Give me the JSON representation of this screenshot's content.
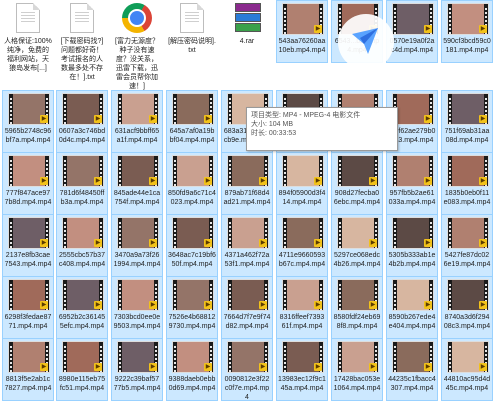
{
  "window": {
    "title": ""
  },
  "colors": {
    "selection": "#cce8ff",
    "selection_border": "#99d1ff",
    "badge": "#f2c21a"
  },
  "files": [
    [
      "人格保证:100%纯净，免费的福利网站，天狼岛发布[...]",
      "[下载密码找?]问题都好奇！考试报名的人数最多处不存在！].txt",
      "[富力无源度？种子没有速度？没关系，迅雷下载，迅雷会员帮你加速！]",
      "[解压密码说明].txt",
      "4.rar",
      "543aa76260aa10eb.mp4.mp4",
      "",
      "",
      ""
    ],
    [
      "5965b2748c96bf7a.mp4.mp4",
      "0607a3c746bd0d4c.mp4.mp4",
      "631acf9bbff65a1f.mp4.mp4",
      "645a7af0a19bbf04.mp4.mp4",
      "683a31cdea05cb9e.mp4.mp4",
      "6999...d09b.mp4.mp4",
      "...4f07.mp4.mp4",
      "...0f62ae279b05a3.mp4.mp4",
      "751f69ab31aa08d.mp4.mp4"
    ],
    [
      "777f847ace977b8d.mp4.mp4",
      "781d6f48450ffb3a.mp4.mp4",
      "845ade44e1ca754f.mp4.mp4",
      "850fd9a6c71c4023.mp4.mp4",
      "879ab71f68d4ad21.mp4.mp4",
      "894f05900d3f414.mp4.mp4",
      "908d27fecba06ebc.mp4.mp4",
      "957fb5b2ae61033a.mp4.mp4",
      "1835b0eb0f11e083.mp4.mp4"
    ],
    [
      "2137e8fb3cae7543.mp4.mp4",
      "2555cbc57b37c408.mp4.mp4",
      "3470a9a73f261994.mp4.mp4",
      "3648ac7c19bf650f.mp4.mp4",
      "4371a462f72a53f1.mp4.mp4",
      "4711e9660593b67c.mp4.mp4",
      "5297ce068edc4b26.mp4.mp4",
      "5305b333ab1e4b2b.mp4.mp4",
      "5427fe87dc026e19.mp4.mp4"
    ],
    [
      "6298f3fedae8771.mp4.mp4",
      "6952b2c361455efc.mp4.mp4",
      "7303bcd0ee0e9503.mp4.mp4",
      "7526e4b688129730.mp4.mp4",
      "7664d7f7e9f74d82.mp4.mp4",
      "8316ffeef739361f.mp4.mp4",
      "8580fdf24eb698f8.mp4.mp4",
      "8590b267ede4e404.mp4.mp4",
      "8740a3d6f29408c3.mp4.mp4"
    ],
    [
      "8813f5e2ab1c7827.mp4.mp4",
      "8980e115eb75fc51.mp4.mp4",
      "9222c39baf5777b5.mp4.mp4",
      "9388daeb0ebb0d69.mp4.mp4",
      "0090812e3f22c0f7e.mp4.mp4",
      "13983ec12f9c145a.mp4.mp4",
      "17428bac053e1064.mp4.mp4",
      "44235c1fbacc4307.mp4.mp4",
      "44810ac95d4d45c.mp4.mp4"
    ]
  ],
  "tooltip": {
    "type": "项目类型: MP4 - MPEG-4 电影文件",
    "size": "大小: 104 MB",
    "duration": "时长: 00:33:53"
  },
  "top_right": {
    "r0c6": "6543...b2c.mp4.mp4",
    "r0c7": "0570e19a0f2ac4d.mp4.mp4",
    "r0c8": "590cf3bcd59c0181.mp4.mp4"
  }
}
